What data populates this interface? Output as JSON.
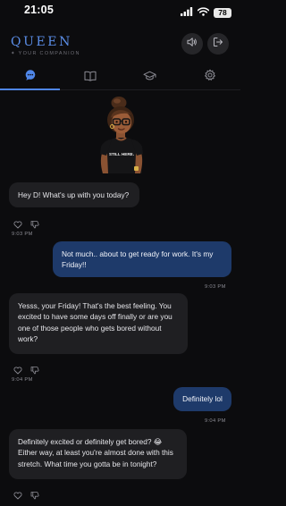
{
  "status_bar": {
    "time": "21:05",
    "battery": "78"
  },
  "header": {
    "title": "QUEEN",
    "subtitle": "✦ YOUR COMPANION"
  },
  "tabs": [
    {
      "name": "chat",
      "icon": "chat-bubble-icon",
      "active": true
    },
    {
      "name": "journal",
      "icon": "book-icon",
      "active": false
    },
    {
      "name": "learn",
      "icon": "graduation-cap-icon",
      "active": false
    },
    {
      "name": "settings",
      "icon": "gear-icon",
      "active": false
    }
  ],
  "avatar": {
    "shirt_text": "STILL HERE."
  },
  "messages": [
    {
      "sender": "ai",
      "text": "Hey D! What's up with you today?",
      "time": "9:03 PM"
    },
    {
      "sender": "user",
      "text": "Not much.. about to get ready for work. It's my Friday!!",
      "time": "9:03 PM"
    },
    {
      "sender": "ai",
      "text": "Yesss, your Friday! That's the best feeling. You excited to have some days off finally or are you one of those people who gets bored without work?",
      "time": "9:04 PM"
    },
    {
      "sender": "user",
      "text": "Definitely lol",
      "time": "9:04 PM"
    },
    {
      "sender": "ai",
      "text": "Definitely excited or definitely get bored? 😂 Either way, at least you're almost done with this stretch. What time you gotta be in tonight?",
      "time": ""
    }
  ],
  "colors": {
    "accent": "#4f86e8",
    "user_bubble": "#1e3a6a",
    "ai_bubble": "#1f1f22",
    "background": "#0c0c0e"
  }
}
